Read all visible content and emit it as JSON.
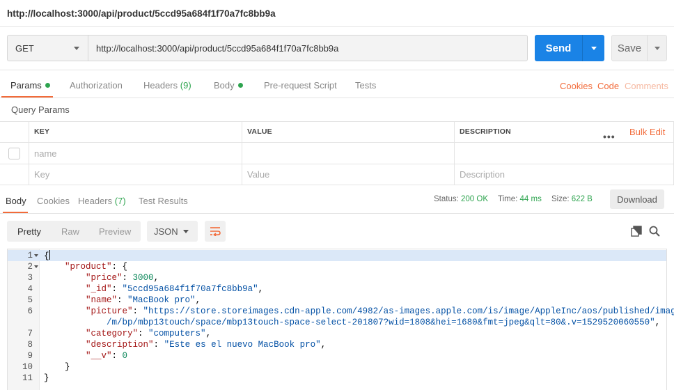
{
  "window": {
    "title": "http://localhost:3000/api/product/5ccd95a684f1f70a7fc8bb9a"
  },
  "request": {
    "method": "GET",
    "url": "http://localhost:3000/api/product/5ccd95a684f1f70a7fc8bb9a",
    "send_label": "Send",
    "save_label": "Save"
  },
  "request_tabs": {
    "params": "Params",
    "authorization": "Authorization",
    "headers": "Headers",
    "headers_count": "(9)",
    "body": "Body",
    "prerequest": "Pre-request Script",
    "tests": "Tests",
    "cookies": "Cookies",
    "code": "Code",
    "comments": "Comments"
  },
  "query_params": {
    "title": "Query Params",
    "columns": {
      "key": "KEY",
      "value": "VALUE",
      "description": "DESCRIPTION"
    },
    "bulk_edit": "Bulk Edit",
    "row1": {
      "key": "name"
    },
    "placeholders": {
      "key": "Key",
      "value": "Value",
      "description": "Description"
    }
  },
  "response_tabs": {
    "body": "Body",
    "cookies": "Cookies",
    "headers": "Headers",
    "headers_count": "(7)",
    "test_results": "Test Results"
  },
  "response_meta": {
    "status_label": "Status:",
    "status_value": "200 OK",
    "time_label": "Time:",
    "time_value": "44 ms",
    "size_label": "Size:",
    "size_value": "622 B",
    "download_label": "Download"
  },
  "format_bar": {
    "pretty": "Pretty",
    "raw": "Raw",
    "preview": "Preview",
    "language": "JSON"
  },
  "colors": {
    "accent": "#f26b3a",
    "send": "#1a83e6",
    "success": "#2ea44f"
  },
  "response_body": {
    "line_numbers": [
      "1",
      "2",
      "3",
      "4",
      "5",
      "6",
      "7",
      "8",
      "9",
      "10",
      "11"
    ],
    "open_brace": "{",
    "product_key": "\"product\"",
    "price_key": "\"price\"",
    "price_value": "3000",
    "id_key": "\"_id\"",
    "id_value": "\"5ccd95a684f1f70a7fc8bb9a\"",
    "name_key": "\"name\"",
    "name_value": "\"MacBook pro\"",
    "picture_key": "\"picture\"",
    "picture_value_1": "\"https://store.storeimages.cdn-apple.com/4982/as-images.apple.com/is/image/AppleInc/aos/published/images",
    "picture_value_2": "/m/bp/mbp13touch/space/mbp13touch-space-select-201807?wid=1808&hei=1680&fmt=jpeg&qlt=80&.v=1529520060550\"",
    "category_key": "\"category\"",
    "category_value": "\"computers\"",
    "description_key": "\"description\"",
    "description_value": "\"Este es el nuevo MacBook pro\"",
    "v_key": "\"__v\"",
    "v_value": "0",
    "close_inner": "}",
    "close_outer": "}"
  }
}
